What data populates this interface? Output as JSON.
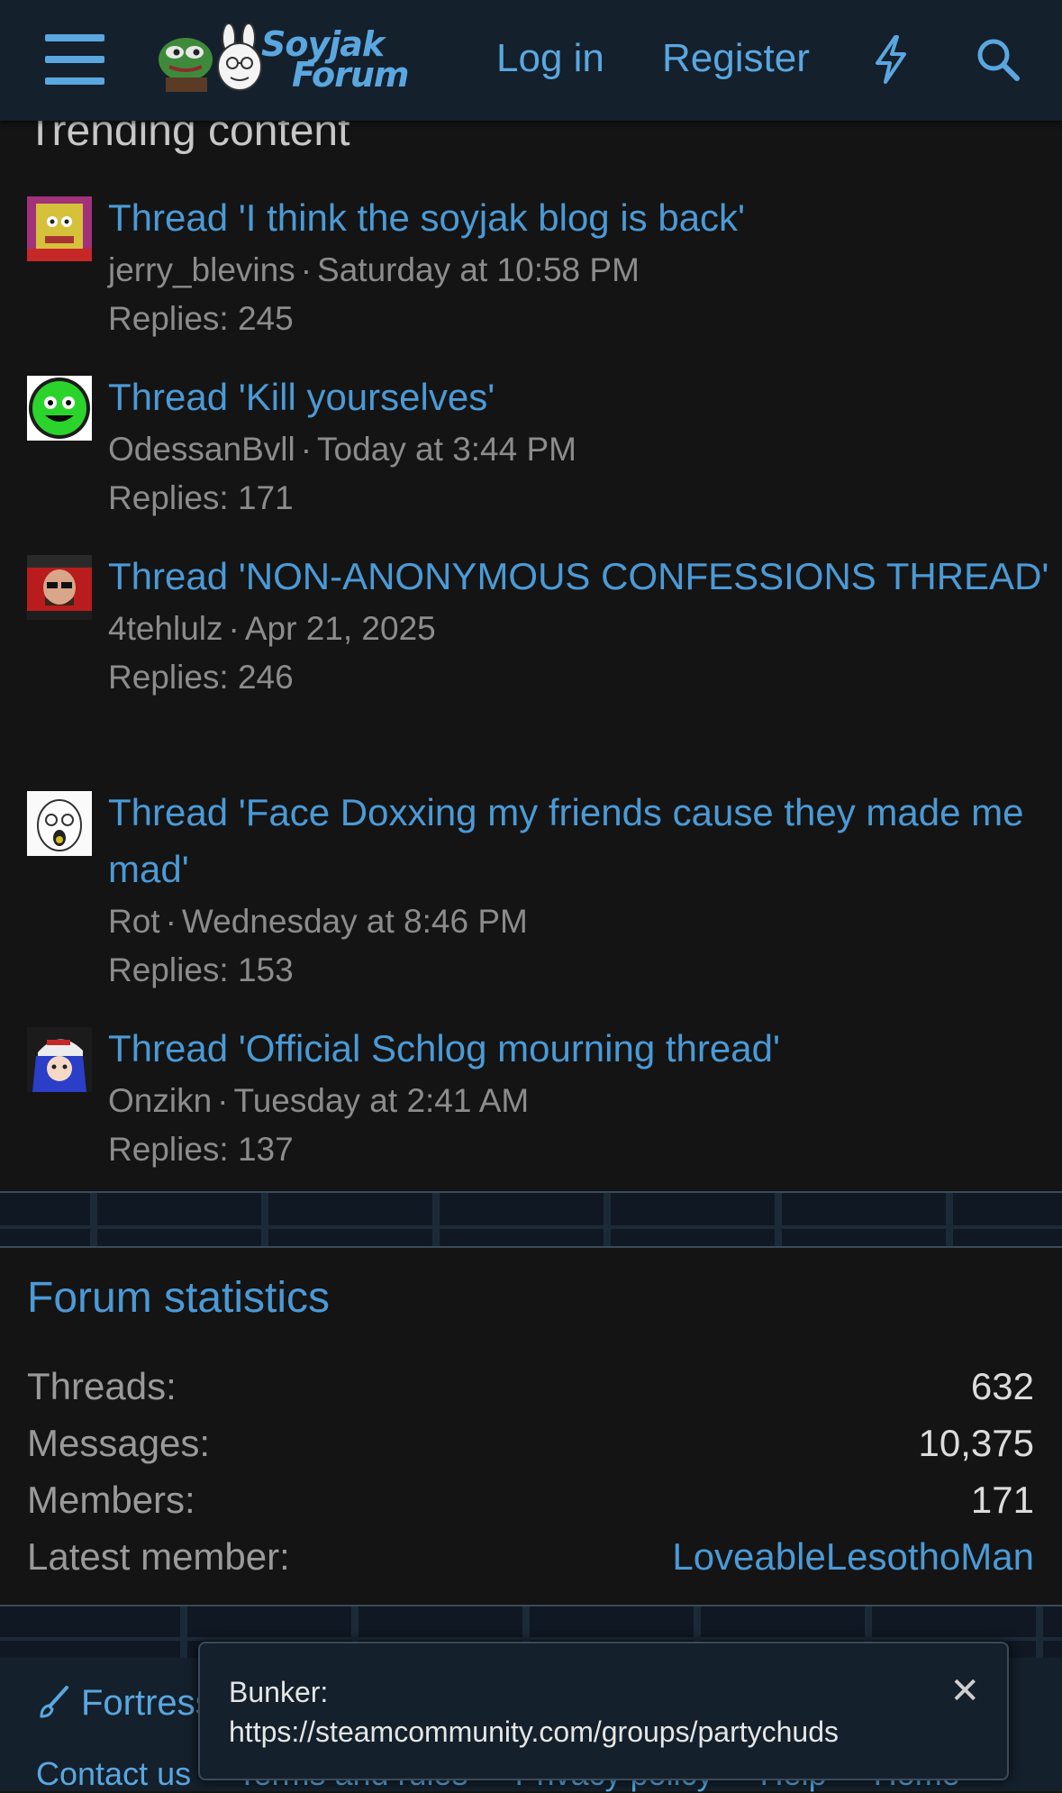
{
  "header": {
    "logo_line1": "Soyjak",
    "logo_line2": "Forum",
    "login_label": "Log in",
    "register_label": "Register"
  },
  "trending": {
    "title": "Trending content",
    "threads": [
      {
        "title": "Thread 'I think the soyjak blog is back'",
        "author": "jerry_blevins",
        "date": "Saturday at 10:58 PM",
        "replies": "Replies: 245"
      },
      {
        "title": "Thread 'Kill yourselves'",
        "author": "OdessanBvll",
        "date": "Today at 3:44 PM",
        "replies": "Replies: 171"
      },
      {
        "title": "Thread 'NON-ANONYMOUS CONFESSIONS THREAD'",
        "author": "4tehlulz",
        "date": "Apr 21, 2025",
        "replies": "Replies: 246"
      },
      {
        "title": "Thread 'Face Doxxing my friends cause they made me mad'",
        "author": "Rot",
        "date": "Wednesday at 8:46 PM",
        "replies": "Replies: 153"
      },
      {
        "title": "Thread 'Official Schlog mourning thread'",
        "author": "Onzikn",
        "date": "Tuesday at 2:41 AM",
        "replies": "Replies: 137"
      }
    ]
  },
  "stats": {
    "title": "Forum statistics",
    "rows": [
      {
        "label": "Threads:",
        "value": "632"
      },
      {
        "label": "Messages:",
        "value": "10,375"
      },
      {
        "label": "Members:",
        "value": "171"
      },
      {
        "label": "Latest member:",
        "value": "LoveableLesothoMan"
      }
    ]
  },
  "footer": {
    "style_label": "Fortress",
    "links": [
      "Contact us",
      "Terms and rules",
      "Privacy policy",
      "Help",
      "Home"
    ]
  },
  "toast": {
    "line1": "Bunker:",
    "line2": "https://steamcommunity.com/groups/partychuds",
    "close": "✕"
  },
  "colors": {
    "accent": "#4b9ad6",
    "header_bg": "#14202c",
    "page_bg": "#141414"
  }
}
